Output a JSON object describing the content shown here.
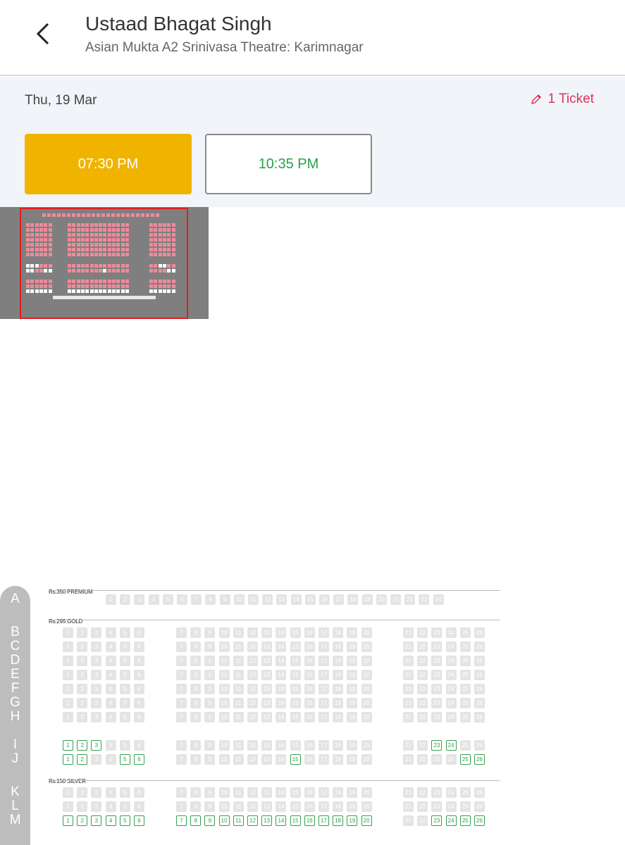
{
  "header": {
    "title": "Ustaad Bhagat Singh",
    "subtitle": "Asian Mukta A2 Srinivasa Theatre: Karimnagar",
    "back_icon": "chevron-left-icon"
  },
  "date_bar": {
    "date": "Thu, 19 Mar",
    "ticket_label": "1 Ticket",
    "ticket_icon": "pencil-icon",
    "ticket_color": "#dc3558"
  },
  "showtimes": [
    {
      "label": "07:30 PM",
      "state": "selected",
      "color": "#f0b400"
    },
    {
      "label": "10:35 PM",
      "state": "available",
      "color": "#2aa04a"
    }
  ],
  "row_labels": [
    "A",
    "B",
    "C",
    "D",
    "E",
    "F",
    "G",
    "H",
    "I",
    "J",
    "K",
    "L",
    "M"
  ],
  "seat_map": {
    "categories": [
      {
        "label": "Rs.350  PREMIUM",
        "rows": [
          "A"
        ]
      },
      {
        "label": "Rs.295  GOLD",
        "rows": [
          "B",
          "C",
          "D",
          "E",
          "F",
          "G",
          "H",
          "I",
          "J"
        ]
      },
      {
        "label": "Rs.150  SILVER",
        "rows": [
          "K",
          "L",
          "M"
        ]
      }
    ],
    "rows": [
      {
        "row": "A",
        "seats": [
          1,
          2,
          3,
          4,
          5,
          6,
          7,
          8,
          9,
          10,
          11,
          12,
          13,
          14,
          15,
          16,
          17,
          18,
          19,
          20,
          21,
          22,
          23,
          24
        ],
        "available": []
      },
      {
        "row": "B",
        "seats": "1-26",
        "available": []
      },
      {
        "row": "C",
        "seats": "1-26",
        "available": []
      },
      {
        "row": "D",
        "seats": "1-26",
        "available": []
      },
      {
        "row": "E",
        "seats": "1-26",
        "available": []
      },
      {
        "row": "F",
        "seats": "1-26",
        "available": []
      },
      {
        "row": "G",
        "seats": "1-26",
        "available": []
      },
      {
        "row": "H",
        "seats": "1-26",
        "available": []
      },
      {
        "row": "I",
        "seats": "1-26",
        "available": [
          1,
          2,
          3,
          23,
          24
        ]
      },
      {
        "row": "J",
        "seats": "1-26",
        "available": [
          1,
          2,
          5,
          6,
          15,
          25,
          26
        ]
      },
      {
        "row": "K",
        "seats": "1-26",
        "available": []
      },
      {
        "row": "L",
        "seats": "1-26",
        "available": []
      },
      {
        "row": "M",
        "seats": "1-26",
        "available": [
          1,
          2,
          3,
          4,
          5,
          6,
          7,
          8,
          9,
          10,
          11,
          12,
          13,
          14,
          15,
          16,
          17,
          18,
          19,
          20,
          23,
          24,
          25,
          26
        ]
      }
    ],
    "colors": {
      "available": "#35a04f",
      "unavailable": "#e4e4e4"
    }
  },
  "minimap": {
    "frame_color": "#e21d1d",
    "seat_color": "#f08a9a",
    "available_color": "#ffffff"
  }
}
